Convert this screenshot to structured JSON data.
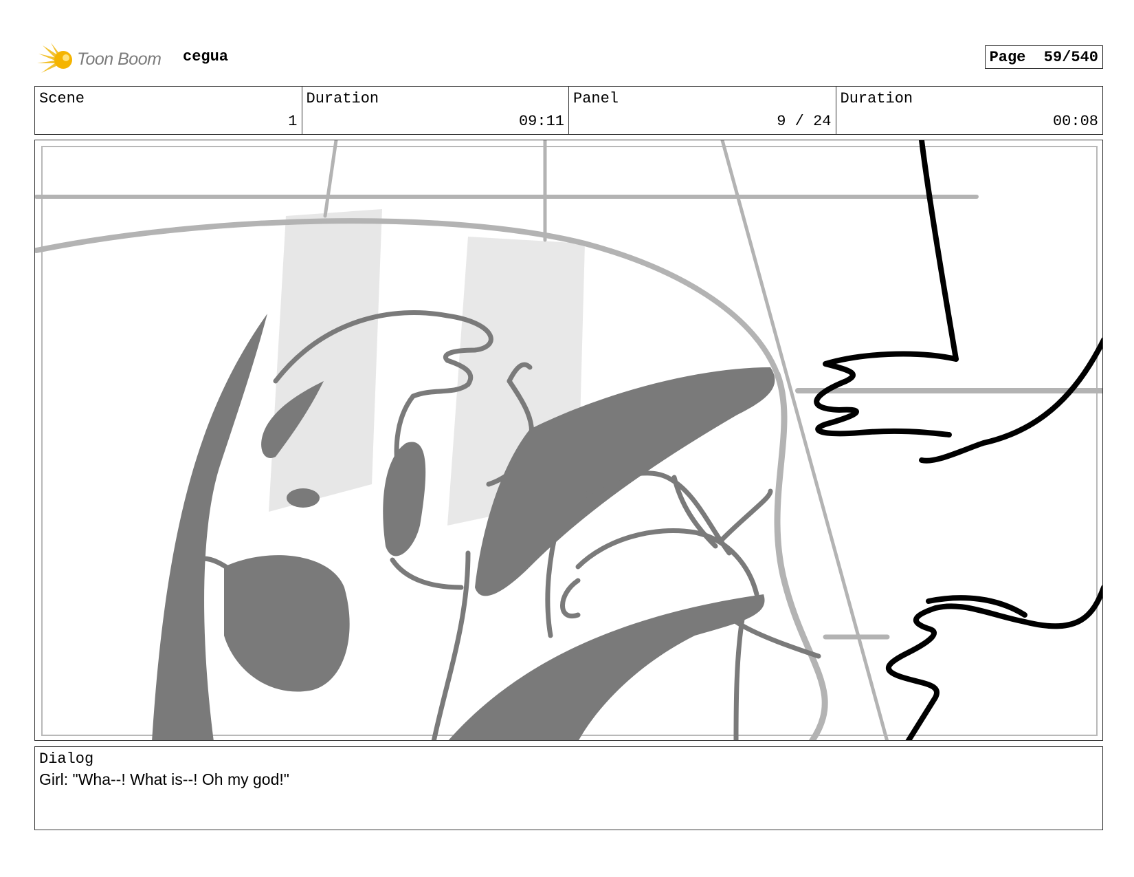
{
  "header": {
    "brand": "Toon Boom",
    "project": "cegua",
    "page_label": "Page",
    "page_value": "59/540"
  },
  "info": {
    "scene_label": "Scene",
    "scene_value": "1",
    "duration_label": "Duration",
    "duration_value": "09:11",
    "panel_label": "Panel",
    "panel_value": "9 / 24",
    "panel_duration_label": "Duration",
    "panel_duration_value": "00:08"
  },
  "dialog": {
    "label": "Dialog",
    "text": "Girl: \"Wha--! What is--! Oh my god!\""
  },
  "colors": {
    "logo_yellow": "#f2c230",
    "logo_text": "#7b7b7b",
    "sketch_gray": "#7a7a7a",
    "guide_gray": "#b3b3b3",
    "ink": "#000000"
  }
}
